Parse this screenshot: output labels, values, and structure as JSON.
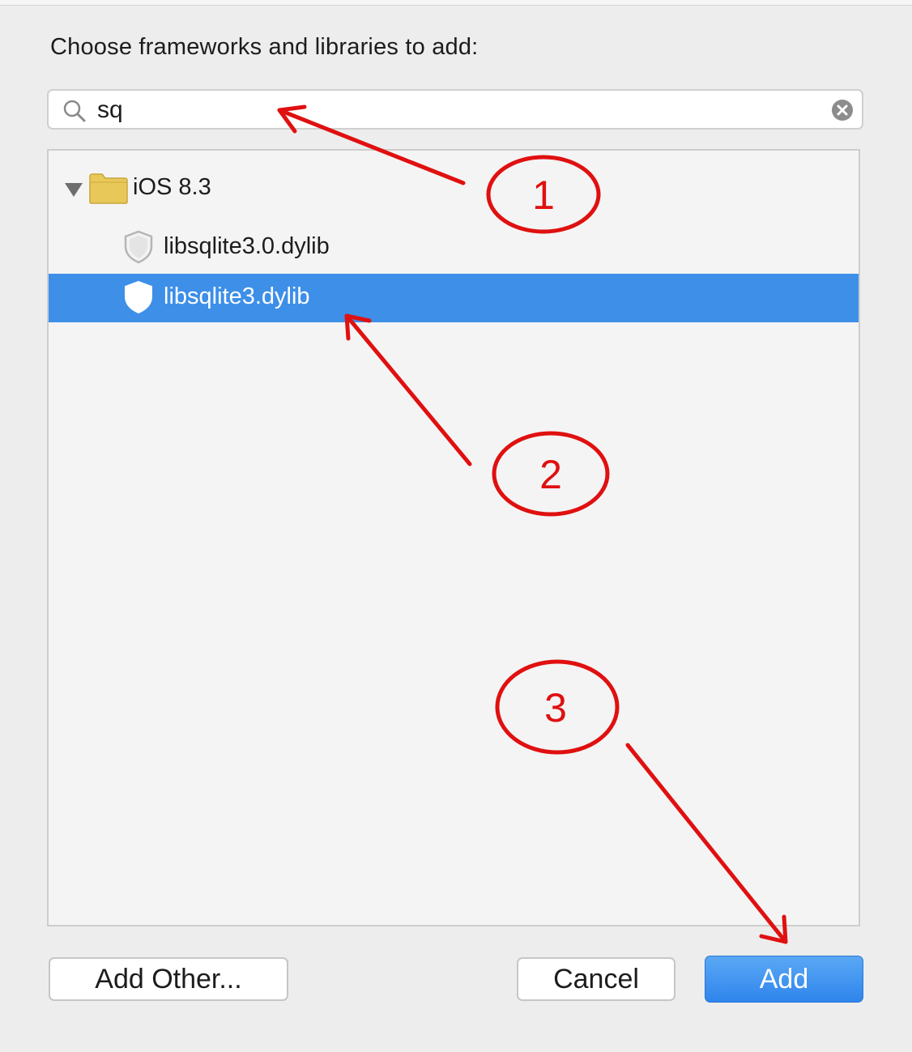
{
  "dialog": {
    "title": "Choose frameworks and libraries to add:"
  },
  "search": {
    "value": "sq",
    "icon": "search-icon",
    "clear_icon": "clear-icon"
  },
  "tree": {
    "group": {
      "label": "iOS 8.3",
      "expanded": true,
      "icon": "folder-icon"
    },
    "items": [
      {
        "label": "libsqlite3.0.dylib",
        "icon": "library-icon",
        "selected": false
      },
      {
        "label": "libsqlite3.dylib",
        "icon": "library-icon",
        "selected": true
      }
    ]
  },
  "buttons": {
    "add_other": "Add Other...",
    "cancel": "Cancel",
    "add": "Add"
  },
  "annotations": {
    "step1": "1",
    "step2": "2",
    "step3": "3",
    "color": "#e01010"
  },
  "colors": {
    "selection": "#3d8fe8",
    "primary_button": "#2f85ec",
    "background": "#ededed"
  }
}
